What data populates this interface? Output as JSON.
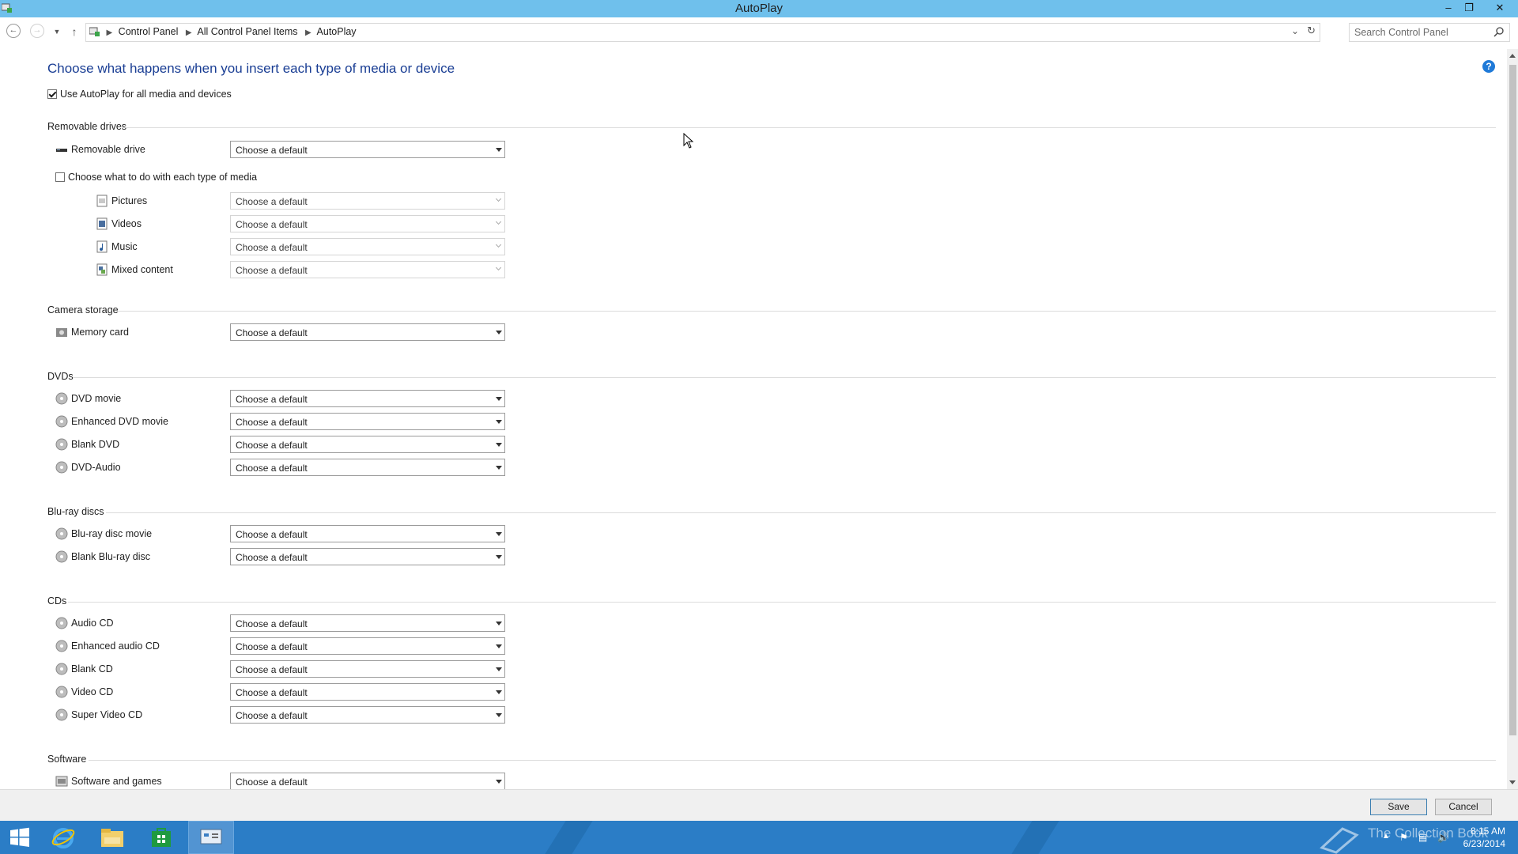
{
  "window": {
    "title": "AutoPlay",
    "controls": [
      "minimize-icon",
      "restore-icon",
      "close-icon"
    ]
  },
  "address_bar": {
    "breadcrumbs": [
      "Control Panel",
      "All Control Panel Items",
      "AutoPlay"
    ],
    "search_placeholder": "Search Control Panel"
  },
  "page": {
    "heading": "Choose what happens when you insert each type of media or device",
    "use_autoplay": {
      "label": "Use AutoPlay for all media and devices",
      "checked": true
    },
    "default_option": "Choose a default"
  },
  "sections": {
    "removable": {
      "title": "Removable drives",
      "drive": {
        "label": "Removable drive",
        "value": "Choose a default",
        "icon": "removable-drive-icon"
      },
      "per_media_checkbox": {
        "label": "Choose what to do with each type of media",
        "checked": false
      },
      "media": [
        {
          "label": "Pictures",
          "value": "Choose a default",
          "icon": "pictures-icon"
        },
        {
          "label": "Videos",
          "value": "Choose a default",
          "icon": "videos-icon"
        },
        {
          "label": "Music",
          "value": "Choose a default",
          "icon": "music-icon"
        },
        {
          "label": "Mixed content",
          "value": "Choose a default",
          "icon": "mixed-content-icon"
        }
      ]
    },
    "camera": {
      "title": "Camera storage",
      "items": [
        {
          "label": "Memory card",
          "value": "Choose a default",
          "icon": "memory-card-icon"
        }
      ]
    },
    "dvds": {
      "title": "DVDs",
      "items": [
        {
          "label": "DVD movie",
          "value": "Choose a default",
          "icon": "disc-icon"
        },
        {
          "label": "Enhanced DVD movie",
          "value": "Choose a default",
          "icon": "disc-icon"
        },
        {
          "label": "Blank DVD",
          "value": "Choose a default",
          "icon": "disc-icon"
        },
        {
          "label": "DVD-Audio",
          "value": "Choose a default",
          "icon": "disc-icon"
        }
      ]
    },
    "bluray": {
      "title": "Blu-ray discs",
      "items": [
        {
          "label": "Blu-ray disc movie",
          "value": "Choose a default",
          "icon": "disc-icon"
        },
        {
          "label": "Blank Blu-ray disc",
          "value": "Choose a default",
          "icon": "disc-icon"
        }
      ]
    },
    "cds": {
      "title": "CDs",
      "items": [
        {
          "label": "Audio CD",
          "value": "Choose a default",
          "icon": "disc-icon"
        },
        {
          "label": "Enhanced audio CD",
          "value": "Choose a default",
          "icon": "disc-icon"
        },
        {
          "label": "Blank CD",
          "value": "Choose a default",
          "icon": "disc-icon"
        },
        {
          "label": "Video CD",
          "value": "Choose a default",
          "icon": "disc-icon"
        },
        {
          "label": "Super Video CD",
          "value": "Choose a default",
          "icon": "disc-icon"
        }
      ]
    },
    "software": {
      "title": "Software",
      "items": [
        {
          "label": "Software and games",
          "value": "Choose a default",
          "icon": "software-icon"
        }
      ]
    }
  },
  "footer": {
    "save": "Save",
    "cancel": "Cancel"
  },
  "taskbar": {
    "apps": [
      "start-icon",
      "internet-explorer-icon",
      "file-explorer-icon",
      "store-icon",
      "control-panel-icon"
    ],
    "watermark": "The Collection Book",
    "clock_time": "8:15 AM",
    "clock_date": "6/23/2014"
  },
  "colors": {
    "titlebar": "#6fc0ec",
    "heading": "#1a3e94",
    "taskbar": "#2b7dc6",
    "help": "#1f7ad8"
  }
}
